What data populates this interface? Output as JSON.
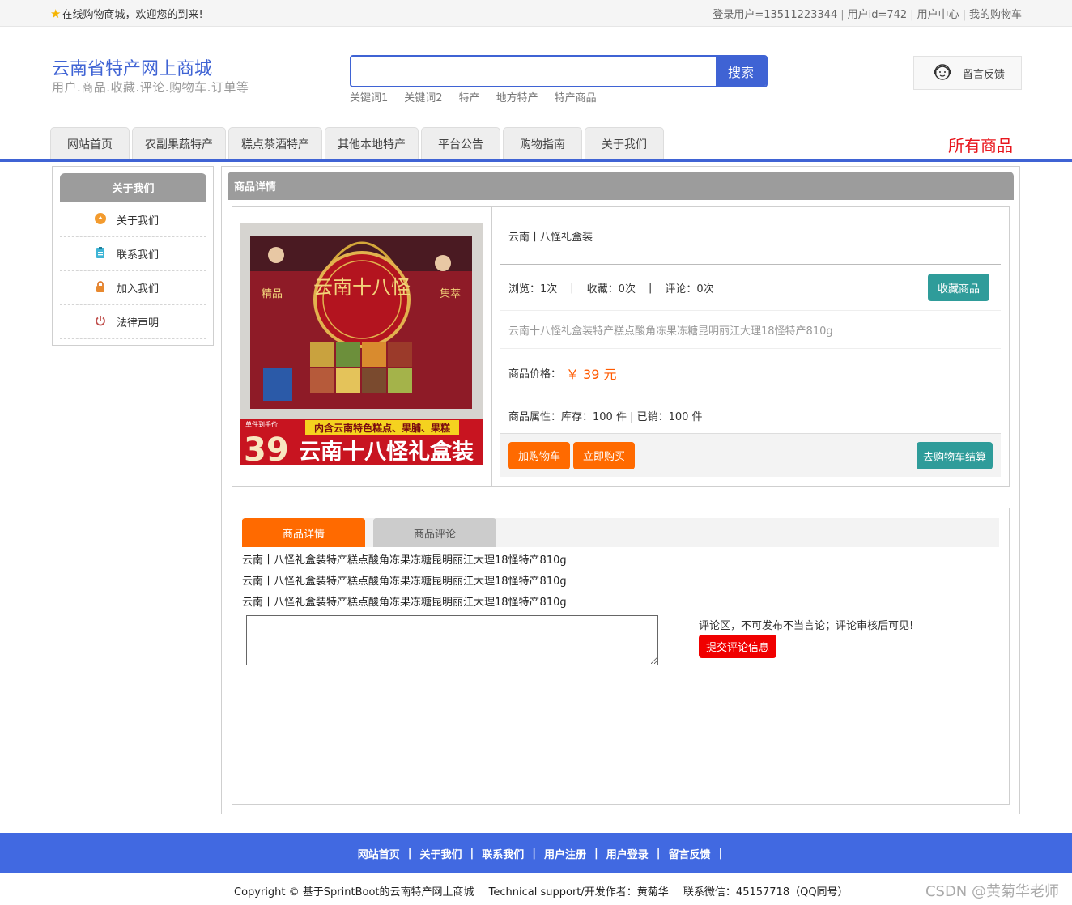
{
  "topbar": {
    "welcome": "在线购物商城，欢迎您的到来!",
    "links": [
      "登录用户=13511223344",
      "用户id=742",
      "用户中心",
      "我的购物车"
    ]
  },
  "header": {
    "title": "云南省特产网上商城",
    "subtitle": "用户.商品.收藏.评论.购物车.订单等",
    "search": {
      "value": "",
      "placeholder": "",
      "button": "搜索"
    },
    "keywords": [
      "关键词1",
      "关键词2",
      "特产",
      "地方特产",
      "特产商品"
    ],
    "feedback": "留言反馈"
  },
  "nav": {
    "tabs": [
      "网站首页",
      "农副果蔬特产",
      "糕点茶酒特产",
      "其他本地特产",
      "平台公告",
      "购物指南",
      "关于我们"
    ],
    "all_goods": "所有商品"
  },
  "sidebar": {
    "title": "关于我们",
    "items": [
      "关于我们",
      "联系我们",
      "加入我们",
      "法律声明"
    ]
  },
  "main": {
    "title": "商品详情",
    "product": {
      "name": "云南十八怪礼盒装",
      "stats": {
        "views": "浏览：1次",
        "favorites": "收藏：0次",
        "comments": "评论：0次"
      },
      "favorite_button": "收藏商品",
      "subtitle": "云南十八怪礼盒装特产糕点酸角冻果冻糖昆明丽江大理18怪特产810g",
      "price_label": "商品价格：",
      "price": "￥ 39 元",
      "attr_label": "商品属性：",
      "attr_value": "库存：100 件 | 已销：100 件",
      "add_cart_button": "加购物车",
      "buy_now_button": "立即购买",
      "checkout_button": "去购物车结算",
      "image": {
        "banner_small": "单件到手价",
        "banner_top": "内含云南特色糕点、果脯、果糕",
        "banner_price": "39",
        "banner_title": "云南十八怪礼盒装",
        "box_title": "云南十八怪",
        "box_tag_left": "精品",
        "box_tag_right": "集萃"
      }
    },
    "tabs": [
      "商品详情",
      "商品评论"
    ],
    "description_lines": [
      "云南十八怪礼盒装特产糕点酸角冻果冻糖昆明丽江大理18怪特产810g",
      "云南十八怪礼盒装特产糕点酸角冻果冻糖昆明丽江大理18怪特产810g",
      "云南十八怪礼盒装特产糕点酸角冻果冻糖昆明丽江大理18怪特产810g"
    ],
    "comment": {
      "value": "",
      "note": "评论区，不可发布不当言论；评论审核后可见!",
      "submit": "提交评论信息"
    }
  },
  "footer": {
    "links": [
      "网站首页",
      "关于我们",
      "联系我们",
      "用户注册",
      "用户登录",
      "留言反馈"
    ],
    "copyright": "Copyright © 基于SprintBoot的云南特产网上商城",
    "support": "Technical support/开发作者：黄菊华",
    "contact": "联系微信：45157718（QQ同号）",
    "watermark": "CSDN @黄菊华老师"
  },
  "colors": {
    "primary": "#4169e1",
    "title_blue": "#3f63d4",
    "orange": "#ff6a00",
    "teal": "#2f9c9a",
    "red": "#e8161d",
    "panel_gray": "#9c9c9c"
  }
}
